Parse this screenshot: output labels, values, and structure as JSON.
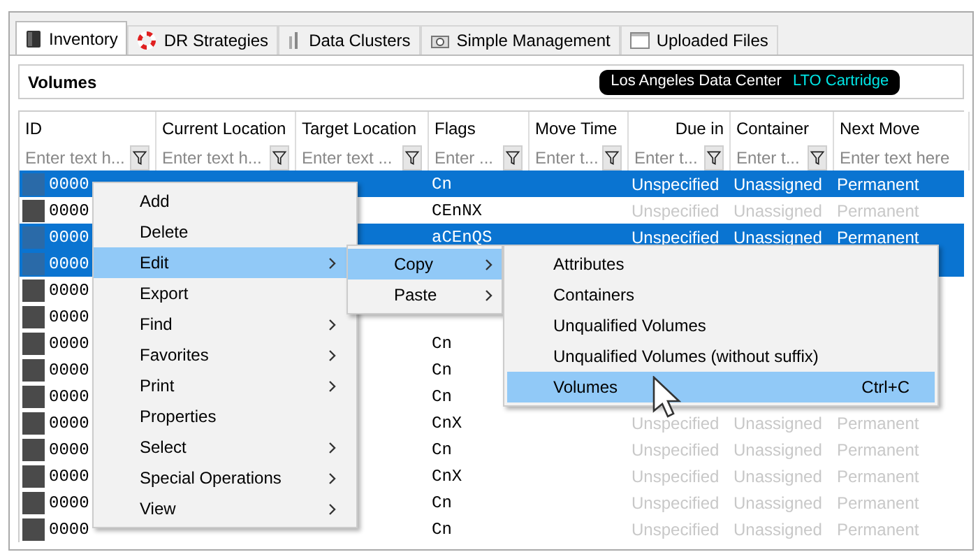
{
  "tabs": [
    {
      "label": "Inventory",
      "selected": true,
      "kind": "volume"
    },
    {
      "label": "DR Strategies",
      "selected": false,
      "kind": "lifebuoy"
    },
    {
      "label": "Data Clusters",
      "selected": false,
      "kind": "cluster"
    },
    {
      "label": "Simple Management",
      "selected": false,
      "kind": "camera"
    },
    {
      "label": "Uploaded Files",
      "selected": false,
      "kind": "window"
    }
  ],
  "panel": {
    "title": "Volumes",
    "location_badge": {
      "location": "Los Angeles Data Center",
      "media": "LTO Cartridge"
    }
  },
  "table": {
    "columns": [
      {
        "title": "ID",
        "placeholder": "Enter text h...",
        "filter": true
      },
      {
        "title": "Current Location",
        "placeholder": "Enter text h...",
        "filter": true
      },
      {
        "title": "Target Location",
        "placeholder": "Enter text ...",
        "filter": true
      },
      {
        "title": "Flags",
        "placeholder": "Enter ...",
        "filter": true
      },
      {
        "title": "Move Time",
        "placeholder": "Enter t...",
        "filter": true
      },
      {
        "title": "Due in",
        "placeholder": "Enter t...",
        "filter": true
      },
      {
        "title": "Container",
        "placeholder": "Enter t...",
        "filter": true
      },
      {
        "title": "Next Move",
        "placeholder": "Enter text here",
        "filter": false
      }
    ],
    "rows": [
      {
        "selected": true,
        "id": "0000",
        "flags": "Cn",
        "due_in": "Unspecified",
        "container": "Unassigned",
        "next_move": "Permanent"
      },
      {
        "selected": false,
        "id": "0000",
        "flags": "CEnNX",
        "due_in": "Unspecified",
        "container": "Unassigned",
        "next_move": "Permanent"
      },
      {
        "selected": true,
        "id": "0000",
        "flags": "aCEnQS",
        "due_in": "Unspecified",
        "container": "Unassigned",
        "next_move": "Permanent"
      },
      {
        "selected": true,
        "id": "0000"
      },
      {
        "selected": false,
        "id": "0000"
      },
      {
        "selected": false,
        "id": "0000"
      },
      {
        "selected": false,
        "id": "0000",
        "flags": "Cn"
      },
      {
        "selected": false,
        "id": "0000",
        "flags": "Cn"
      },
      {
        "selected": false,
        "id": "0000",
        "flags": "Cn"
      },
      {
        "selected": false,
        "id": "0000",
        "flags": "CnX",
        "due_in": "Unspecified",
        "container": "Unassigned",
        "next_move": "Permanent"
      },
      {
        "selected": false,
        "id": "0000",
        "flags": "Cn",
        "due_in": "Unspecified",
        "container": "Unassigned",
        "next_move": "Permanent"
      },
      {
        "selected": false,
        "id": "0000",
        "flags": "CnX",
        "due_in": "Unspecified",
        "container": "Unassigned",
        "next_move": "Permanent"
      },
      {
        "selected": false,
        "id": "0000",
        "flags": "Cn",
        "due_in": "Unspecified",
        "container": "Unassigned",
        "next_move": "Permanent"
      },
      {
        "selected": false,
        "id": "0000",
        "flags": "Cn",
        "due_in": "Unspecified",
        "container": "Unassigned",
        "next_move": "Permanent"
      }
    ]
  },
  "context_menu": {
    "items": [
      {
        "label": "Add",
        "has_submenu": false,
        "selected": false
      },
      {
        "label": "Delete",
        "has_submenu": false,
        "selected": false
      },
      {
        "label": "Edit",
        "has_submenu": true,
        "selected": true
      },
      {
        "label": "Export",
        "has_submenu": false,
        "selected": false
      },
      {
        "label": "Find",
        "has_submenu": true,
        "selected": false
      },
      {
        "label": "Favorites",
        "has_submenu": true,
        "selected": false
      },
      {
        "label": "Print",
        "has_submenu": true,
        "selected": false
      },
      {
        "label": "Properties",
        "has_submenu": false,
        "selected": false
      },
      {
        "label": "Select",
        "has_submenu": true,
        "selected": false
      },
      {
        "label": "Special Operations",
        "has_submenu": true,
        "selected": false
      },
      {
        "label": "View",
        "has_submenu": true,
        "selected": false
      }
    ]
  },
  "edit_submenu": {
    "items": [
      {
        "label": "Copy",
        "has_submenu": true,
        "selected": true
      },
      {
        "label": "Paste",
        "has_submenu": true,
        "selected": false
      }
    ]
  },
  "copy_submenu": {
    "items": [
      {
        "label": "Attributes",
        "selected": false
      },
      {
        "label": "Containers",
        "selected": false
      },
      {
        "label": "Unqualified Volumes",
        "selected": false
      },
      {
        "label": "Unqualified Volumes (without suffix)",
        "selected": false
      },
      {
        "label": "Volumes",
        "shortcut": "Ctrl+C",
        "selected": true
      }
    ]
  }
}
